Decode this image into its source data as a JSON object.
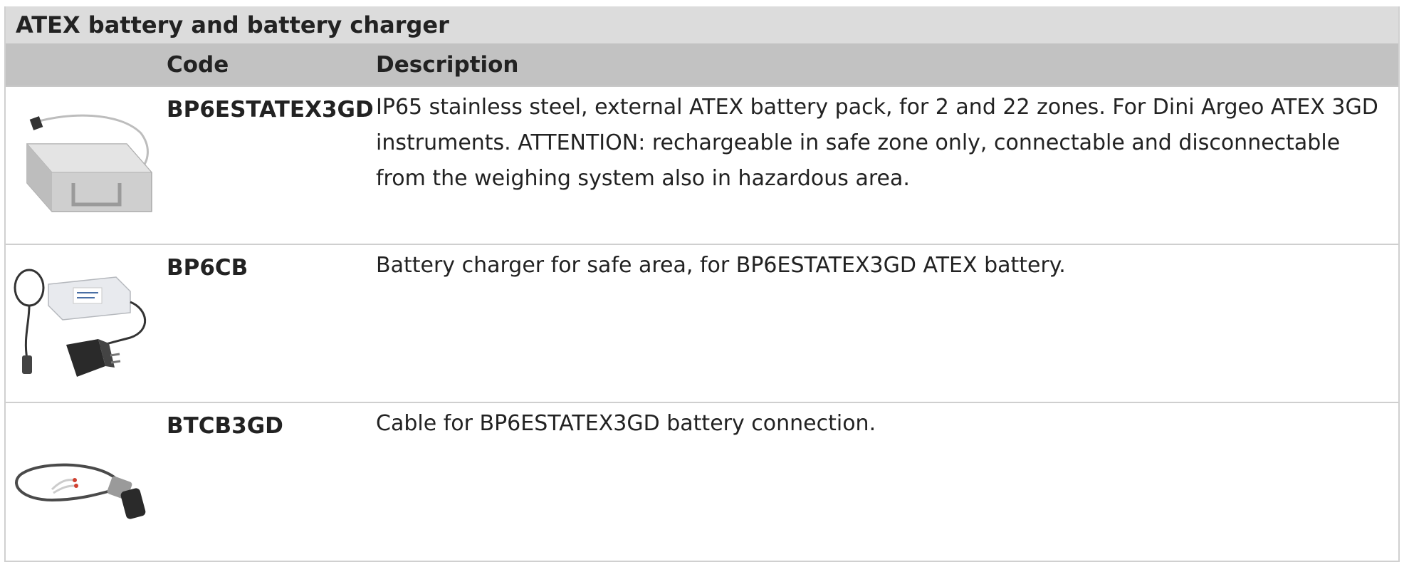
{
  "section": {
    "title": "ATEX battery and battery charger"
  },
  "table": {
    "headers": {
      "image": "",
      "code": "Code",
      "description": "Description"
    },
    "rows": [
      {
        "code": "BP6ESTATEX3GD",
        "description": "IP65 stainless steel, external ATEX battery pack, for 2 and 22 zones. For Dini Argeo ATEX 3GD instruments. ATTENTION: rechargeable in safe zone only, connectable and disconnectable from the weighing system also in hazardous area.",
        "image_icon": "battery-pack-image"
      },
      {
        "code": "BP6CB",
        "description": "Battery charger for safe area, for BP6ESTATEX3GD ATEX battery.",
        "image_icon": "battery-charger-image"
      },
      {
        "code": "BTCB3GD",
        "description": "Cable for BP6ESTATEX3GD battery connection.",
        "image_icon": "cable-image"
      }
    ]
  }
}
